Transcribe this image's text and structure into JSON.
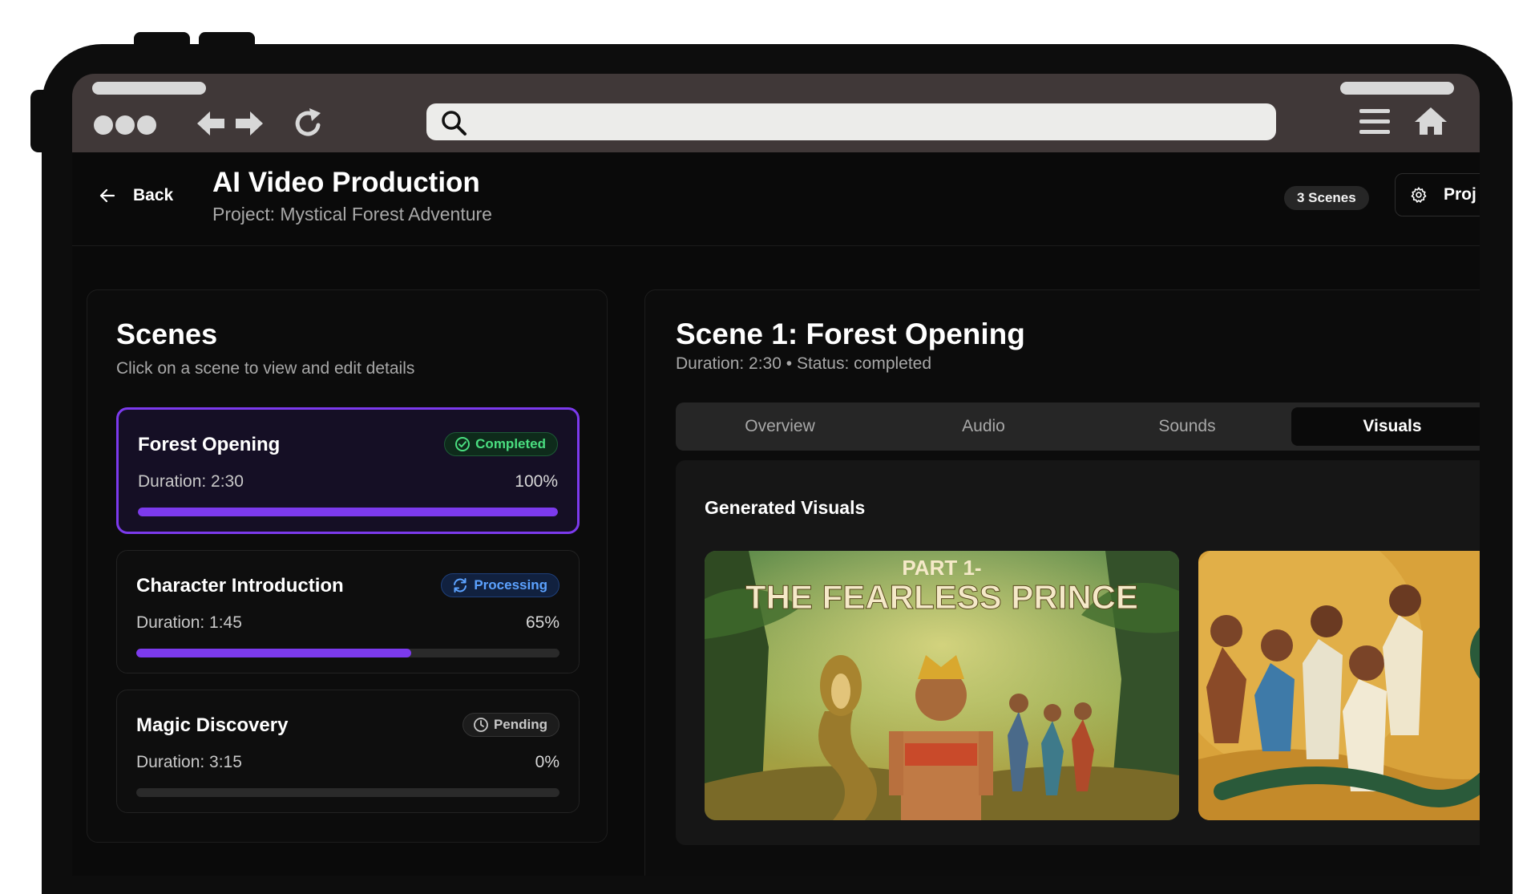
{
  "browser": {
    "url_placeholder": "",
    "icons": [
      "dots-icon",
      "back-arrow-icon",
      "forward-arrow-icon",
      "reload-icon",
      "search-icon",
      "menu-icon",
      "home-icon"
    ]
  },
  "header": {
    "back_label": "Back",
    "title": "AI Video Production",
    "subtitle": "Project: Mystical Forest Adventure",
    "scenes_badge": "3 Scenes",
    "project_button_label": "Proj"
  },
  "scenes_panel": {
    "title": "Scenes",
    "subtitle": "Click on a scene to view and edit details",
    "items": [
      {
        "name": "Forest Opening",
        "status": "Completed",
        "duration": "Duration: 2:30",
        "progress_label": "100%",
        "progress": 100,
        "selected": true
      },
      {
        "name": "Character Introduction",
        "status": "Processing",
        "duration": "Duration: 1:45",
        "progress_label": "65%",
        "progress": 65,
        "selected": false
      },
      {
        "name": "Magic Discovery",
        "status": "Pending",
        "duration": "Duration: 3:15",
        "progress_label": "0%",
        "progress": 0,
        "selected": false
      }
    ]
  },
  "detail": {
    "title": "Scene 1: Forest Opening",
    "subtitle": "Duration: 2:30 • Status: completed",
    "tabs": [
      "Overview",
      "Audio",
      "Sounds",
      "Visuals"
    ],
    "active_tab": "Visuals",
    "visuals_title": "Generated Visuals",
    "images": [
      {
        "caption_line1": "PART 1-",
        "caption_line2": "THE FEARLESS PRINCE"
      },
      {
        "caption_line1": "",
        "caption_line2": ""
      }
    ]
  },
  "colors": {
    "accent": "#7c3aed",
    "completed": "#4ade80",
    "processing": "#5ca2ff",
    "chrome": "#403838"
  }
}
